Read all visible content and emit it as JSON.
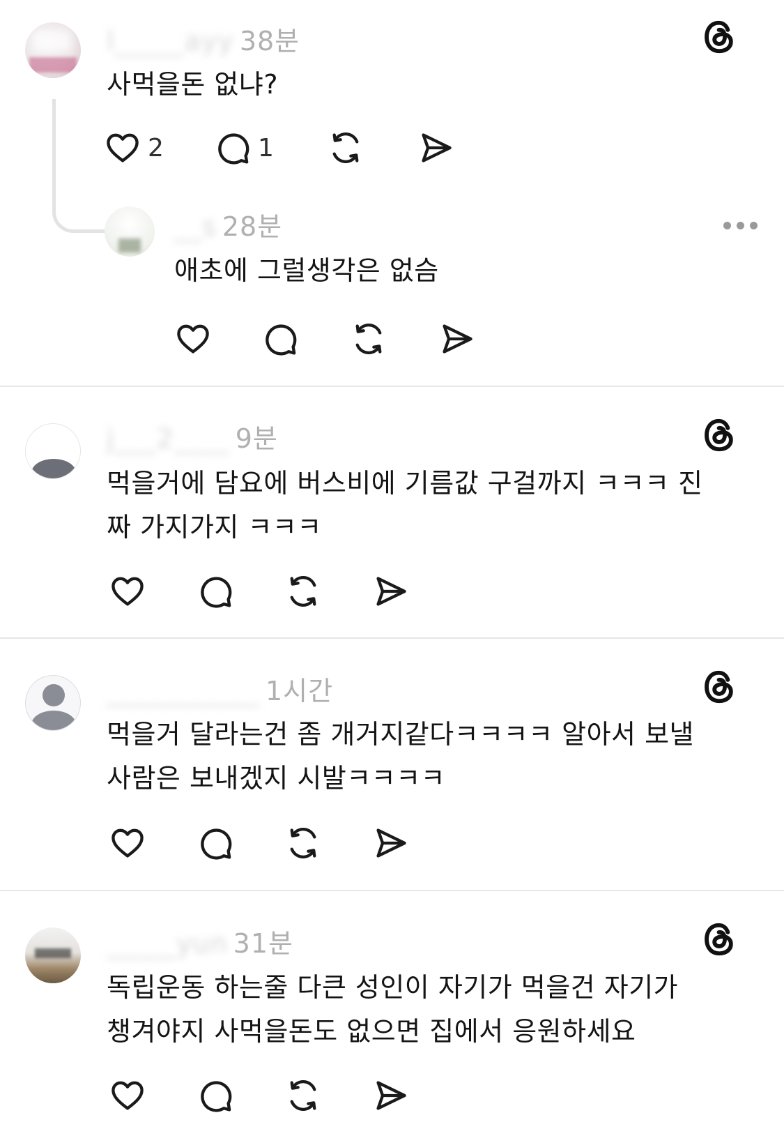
{
  "comments": [
    {
      "username": "l_____ayy",
      "time": "38분",
      "text": "사먹을돈 없냐?",
      "likes": "2",
      "replies": "1",
      "icon": "threads-logo-icon",
      "reply": {
        "username": "__s",
        "time": "28분",
        "text": "애초에 그럴생각은  없슴",
        "menu_icon": "more-icon"
      }
    },
    {
      "username": "j___2____",
      "time": "9분",
      "text_line1": "먹을거에 담요에 버스비에 기름값 구걸까지 ㅋㅋㅋ 진",
      "text_line2": "짜 가지가지 ㅋㅋㅋ",
      "icon": "threads-logo-icon"
    },
    {
      "username": "___________",
      "time": "1시간",
      "text_line1": "먹을거 달라는건 좀 개거지같다ㅋㅋㅋㅋ 알아서 보낼",
      "text_line2": "사람은 보내겠지 시발ㅋㅋㅋㅋ",
      "icon": "threads-logo-icon"
    },
    {
      "username": "_____yun",
      "time": "31분",
      "text_line1": "독립운동 하는줄 다큰 성인이 자기가 먹을건 자기가",
      "text_line2": "챙겨야지 사먹을돈도 없으면 집에서 응원하세요",
      "icon": "threads-logo-icon"
    }
  ],
  "action_icons": [
    "heart-icon",
    "comment-icon",
    "repost-icon",
    "share-icon"
  ]
}
